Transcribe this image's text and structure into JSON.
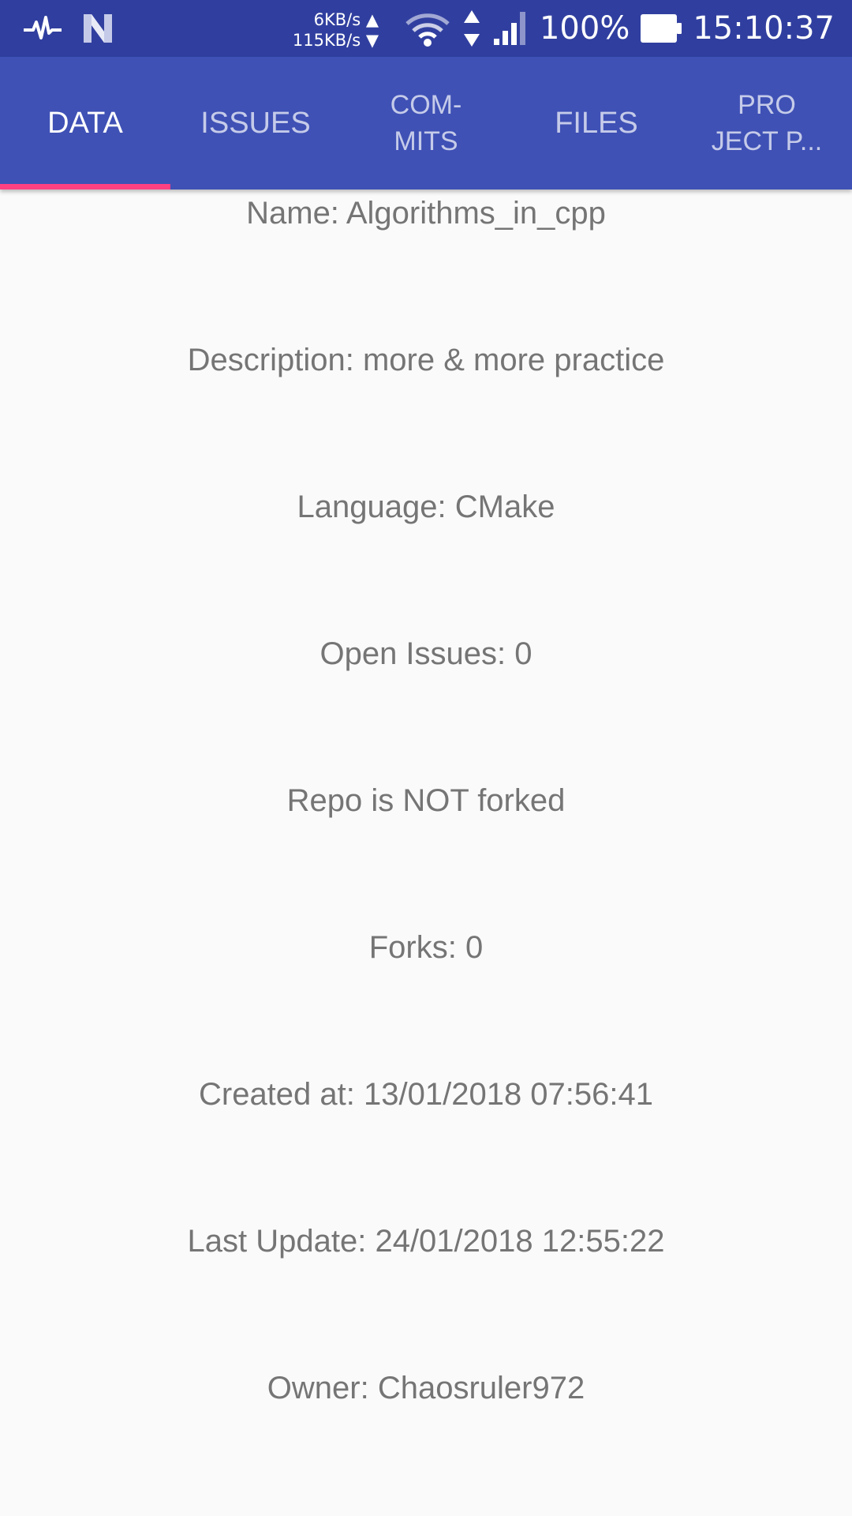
{
  "status_bar": {
    "speed_up": "6KB/s ▲",
    "speed_down": "115KB/s ▼",
    "battery_percent": "100%",
    "time": "15:10:37",
    "icons": [
      "pulse-icon",
      "n-logo-icon",
      "wifi-icon",
      "data-arrows-icon",
      "signal-icon",
      "battery-icon"
    ]
  },
  "tabs": [
    {
      "label": "DATA",
      "active": true
    },
    {
      "label": "ISSUES",
      "active": false
    },
    {
      "label": "COM-\nMITS",
      "active": false
    },
    {
      "label": "FILES",
      "active": false
    },
    {
      "label": "PRO\nJECT P...",
      "active": false
    }
  ],
  "colors": {
    "status_bar": "#303f9f",
    "tab_bar": "#3f51b5",
    "indicator": "#ff4081",
    "text": "#757575",
    "background": "#fafafa"
  },
  "repo": {
    "name": "Name: Algorithms_in_cpp",
    "description": "Description: more & more practice",
    "language": "Language: CMake",
    "open_issues": "Open Issues: 0",
    "forked": "Repo is NOT forked",
    "forks": "Forks: 0",
    "created_at": "Created at: 13/01/2018 07:56:41",
    "last_update": "Last Update: 24/01/2018 12:55:22",
    "owner": "Owner: Chaosruler972"
  }
}
